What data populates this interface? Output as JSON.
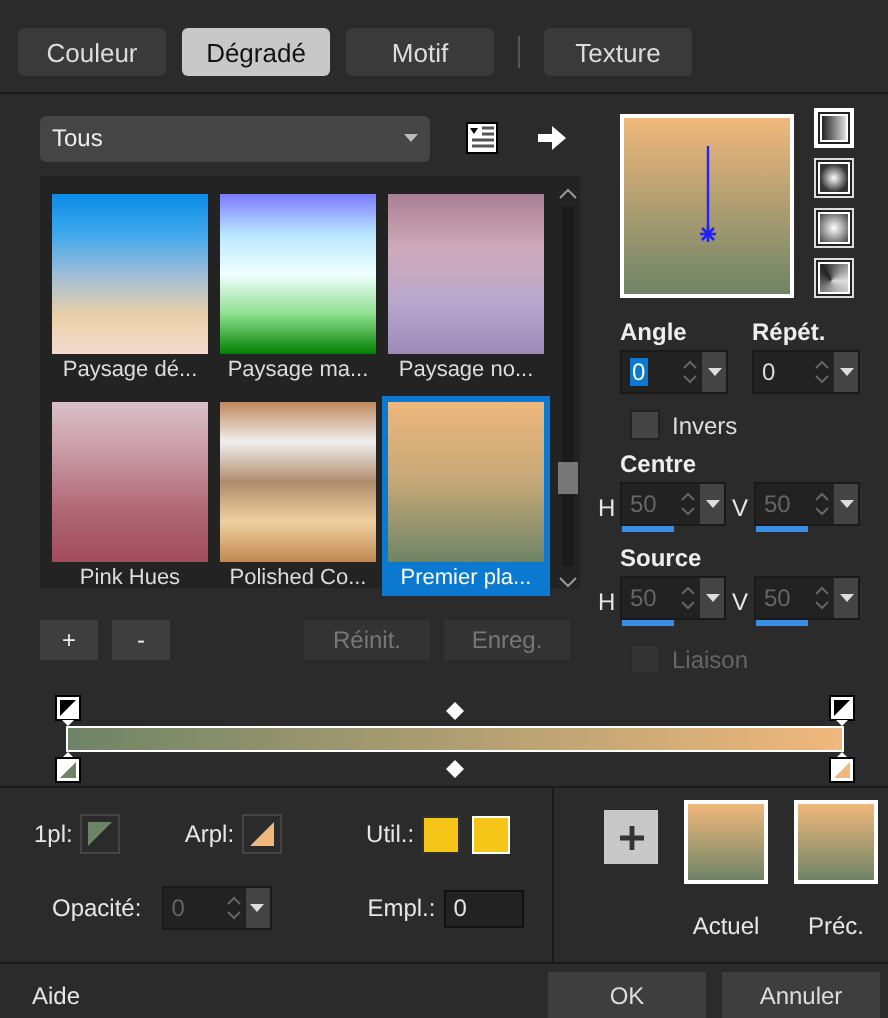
{
  "tabs": [
    {
      "label": "Couleur",
      "selected": false
    },
    {
      "label": "Dégradé",
      "selected": true
    },
    {
      "label": "Motif",
      "selected": false
    },
    {
      "label": "Texture",
      "selected": false
    }
  ],
  "category": {
    "value": "Tous"
  },
  "gallery": [
    {
      "label": "Paysage dé...",
      "selected": false
    },
    {
      "label": "Paysage ma...",
      "selected": false
    },
    {
      "label": "Paysage no...",
      "selected": false
    },
    {
      "label": "Pink Hues",
      "selected": false
    },
    {
      "label": "Polished Co...",
      "selected": false
    },
    {
      "label": "Premier pla...",
      "selected": true
    }
  ],
  "gallery_buttons": [
    {
      "label": "+",
      "disabled": false
    },
    {
      "label": "-",
      "disabled": false
    },
    {
      "label": "Réinit.",
      "disabled": true
    },
    {
      "label": "Enreg.",
      "disabled": true
    }
  ],
  "gradient_styles": [
    {
      "kind": "linear",
      "selected": true
    },
    {
      "kind": "rectangular",
      "selected": false
    },
    {
      "kind": "radial",
      "selected": false
    },
    {
      "kind": "corner",
      "selected": false
    }
  ],
  "spinners": [
    {
      "label": "Angle",
      "value": "0",
      "focused": true
    },
    {
      "label": "Répét.",
      "value": "0",
      "focused": false
    }
  ],
  "invert": {
    "label": "Invers",
    "checked": false,
    "disabled": false
  },
  "positions": [
    {
      "label": "Centre",
      "fields": [
        {
          "axis": "H",
          "value": "50",
          "level": 0.5,
          "disabled": true
        },
        {
          "axis": "V",
          "value": "50",
          "level": 0.5,
          "disabled": true
        }
      ]
    },
    {
      "label": "Source",
      "fields": [
        {
          "axis": "H",
          "value": "50",
          "level": 0.5,
          "disabled": true
        },
        {
          "axis": "V",
          "value": "50",
          "level": 0.5,
          "disabled": true
        }
      ]
    }
  ],
  "link": {
    "label": "Liaison",
    "checked": false,
    "disabled": true
  },
  "swatches": [
    {
      "label": "1pl:",
      "color": "#6e8466"
    },
    {
      "label": "Arpl:",
      "color": "#f0b87c"
    }
  ],
  "used": {
    "label": "Util.:",
    "colors": [
      {
        "color": "#f5c518"
      },
      {
        "color": "#f5c518"
      }
    ]
  },
  "opacity": {
    "label": "Opacité:",
    "value": "0",
    "disabled": true
  },
  "location": {
    "label": "Empl.:",
    "value": "0"
  },
  "history": [
    {
      "label": "Actuel"
    },
    {
      "label": "Préc."
    }
  ],
  "footer": {
    "help": "Aide",
    "ok": "OK",
    "cancel": "Annuler"
  }
}
